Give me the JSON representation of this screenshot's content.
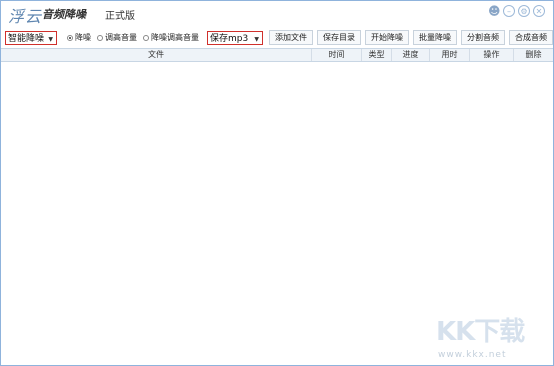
{
  "titlebar": {
    "logo": "浮云",
    "app_title": "音频降噪",
    "edition": "正式版",
    "icons": [
      "user-icon",
      "minimize-icon",
      "settings-icon",
      "close-icon"
    ]
  },
  "toolbar": {
    "mode_select": "智能降噪",
    "radios": [
      {
        "label": "降噪",
        "selected": true
      },
      {
        "label": "调高音量",
        "selected": false
      },
      {
        "label": "降噪调高音量",
        "selected": false
      }
    ],
    "format_select": "保存mp3",
    "buttons": [
      "添加文件",
      "保存目录",
      "开始降噪",
      "批量降噪",
      "分割音频",
      "合成音频"
    ]
  },
  "table": {
    "columns": [
      "文件",
      "时间",
      "类型",
      "进度",
      "用时",
      "操作",
      "删除"
    ]
  },
  "watermark": {
    "main": "KK下载",
    "url": "www.kkx.net"
  },
  "colors": {
    "accent_border": "#d0302c",
    "window_border": "#8fb3dc"
  }
}
